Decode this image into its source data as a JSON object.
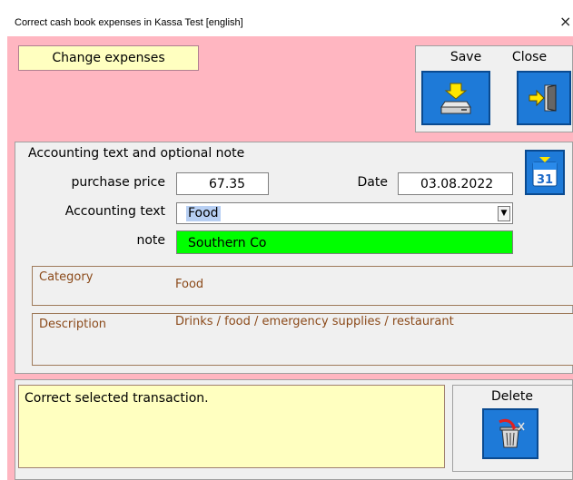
{
  "window": {
    "title": "Correct cash book expenses in Kassa Test  [english]",
    "close_glyph": "×"
  },
  "header": {
    "label": "Change expenses"
  },
  "toolbar": {
    "save_label": "Save",
    "close_label": "Close"
  },
  "section": {
    "title": "Accounting text and optional note"
  },
  "fields": {
    "purchase_price_label": "purchase price",
    "purchase_price_value": "67.35",
    "date_label": "Date",
    "date_value": "03.08.2022",
    "accounting_text_label": "Accounting text",
    "accounting_text_value": "Food",
    "note_label": "note",
    "note_value": "Southern Co"
  },
  "category": {
    "label": "Category",
    "value": "Food"
  },
  "description": {
    "label": "Description",
    "value": "Drinks / food / emergency supplies / restaurant"
  },
  "status": {
    "message": "Correct selected transaction."
  },
  "delete": {
    "label": "Delete"
  },
  "calendar": {
    "day": "31"
  },
  "colors": {
    "form_bg": "#ffb6c1",
    "header_bg": "#ffffc0",
    "button_blue": "#1e7ad8",
    "note_green": "#00ff00",
    "info_text": "#8b4a1a"
  },
  "icons": {
    "save": "save-drive-icon",
    "close": "exit-door-icon",
    "calendar": "calendar-icon",
    "delete": "trash-delete-icon",
    "dropdown": "chevron-down-icon"
  }
}
